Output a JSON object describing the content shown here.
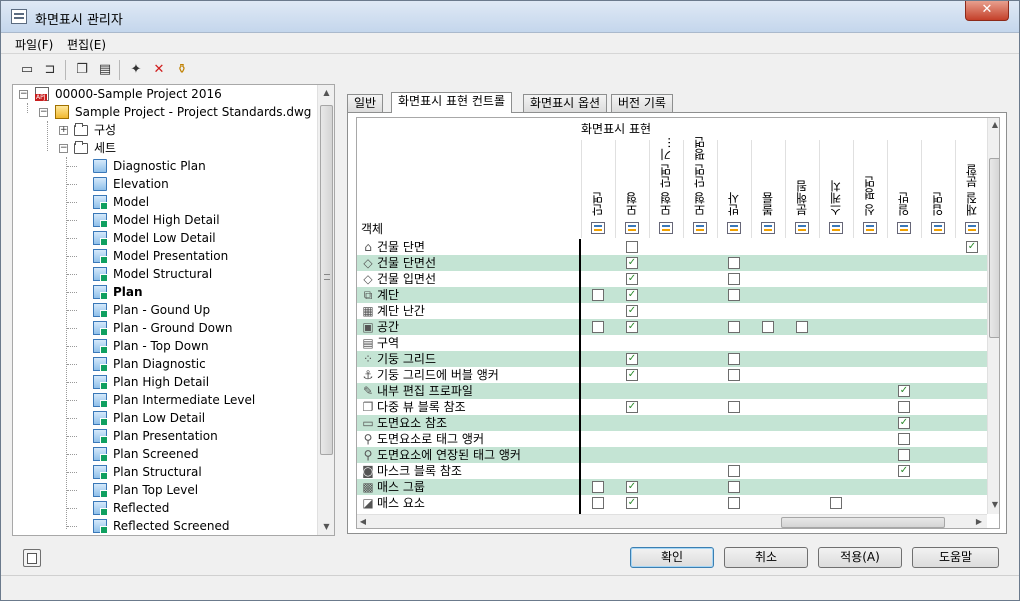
{
  "window": {
    "title": "화면표시 관리자",
    "close": "✕"
  },
  "menu": {
    "file": "파일(F)",
    "edit": "편집(E)"
  },
  "tree": {
    "root": "00000-Sample Project 2016",
    "project": "Sample Project - Project Standards.dwg",
    "config": "구성",
    "sets": "세트",
    "items": [
      "Diagnostic Plan",
      "Elevation",
      "Model",
      "Model High Detail",
      "Model Low Detail",
      "Model Presentation",
      "Model Structural",
      "Plan",
      "Plan - Gound Up",
      "Plan - Ground Down",
      "Plan - Top Down",
      "Plan Diagnostic",
      "Plan High Detail",
      "Plan Intermediate Level",
      "Plan Low Detail",
      "Plan Presentation",
      "Plan Screened",
      "Plan Structural",
      "Plan Top Level",
      "Reflected",
      "Reflected Screened"
    ]
  },
  "tabs": [
    "일반",
    "화면표시 표현 컨트롤",
    "화면표시 옵션",
    "버전 기록"
  ],
  "grid": {
    "group_label": "화면표시 표현",
    "object_label": "객체",
    "columns": [
      "단면",
      "모형",
      "모형 단면 기...",
      "모형 단면 평면",
      "반사",
      "볼륨",
      "분해됨",
      "스케치",
      "싱 평면",
      "일반",
      "입면",
      "재질 분할"
    ],
    "rows": [
      {
        "label": "건물 단면",
        "icon": "⌂",
        "checks": {
          "1": "u",
          "11": "c"
        }
      },
      {
        "label": "건물 단면선",
        "icon": "◇",
        "checks": {
          "1": "c",
          "4": "u"
        }
      },
      {
        "label": "건물 입면선",
        "icon": "◇",
        "checks": {
          "1": "c",
          "4": "u"
        }
      },
      {
        "label": "계단",
        "icon": "⧉",
        "checks": {
          "0": "u",
          "1": "c",
          "4": "u"
        }
      },
      {
        "label": "계단 난간",
        "icon": "▦",
        "checks": {
          "1": "c"
        }
      },
      {
        "label": "공간",
        "icon": "▣",
        "checks": {
          "0": "u",
          "1": "c",
          "4": "u",
          "5": "u",
          "6": "u"
        }
      },
      {
        "label": "구역",
        "icon": "▤",
        "checks": {}
      },
      {
        "label": "기둥 그리드",
        "icon": "⁘",
        "checks": {
          "1": "c",
          "4": "u"
        }
      },
      {
        "label": "기둥 그리드에 버블 앵커",
        "icon": "⚓",
        "checks": {
          "1": "c",
          "4": "u"
        }
      },
      {
        "label": "내부 편집 프로파일",
        "icon": "✎",
        "checks": {
          "9": "c"
        }
      },
      {
        "label": "다중 뷰 블록 참조",
        "icon": "❐",
        "checks": {
          "1": "c",
          "4": "u",
          "9": "u"
        }
      },
      {
        "label": "도면요소 참조",
        "icon": "▭",
        "checks": {
          "9": "c"
        }
      },
      {
        "label": "도면요소로 태그 앵커",
        "icon": "⚲",
        "checks": {
          "9": "u"
        }
      },
      {
        "label": "도면요소에 연장된 태그 앵커",
        "icon": "⚲",
        "checks": {
          "9": "u"
        }
      },
      {
        "label": "마스크 블록 참조",
        "icon": "◙",
        "checks": {
          "4": "u",
          "9": "c"
        }
      },
      {
        "label": "매스 그룹",
        "icon": "▩",
        "checks": {
          "0": "u",
          "1": "c",
          "4": "u"
        }
      },
      {
        "label": "매스 요소",
        "icon": "◪",
        "checks": {
          "0": "u",
          "1": "c",
          "4": "u",
          "7": "u"
        }
      }
    ]
  },
  "buttons": {
    "ok": "확인",
    "cancel": "취소",
    "apply": "적용(A)",
    "help": "도움말"
  }
}
